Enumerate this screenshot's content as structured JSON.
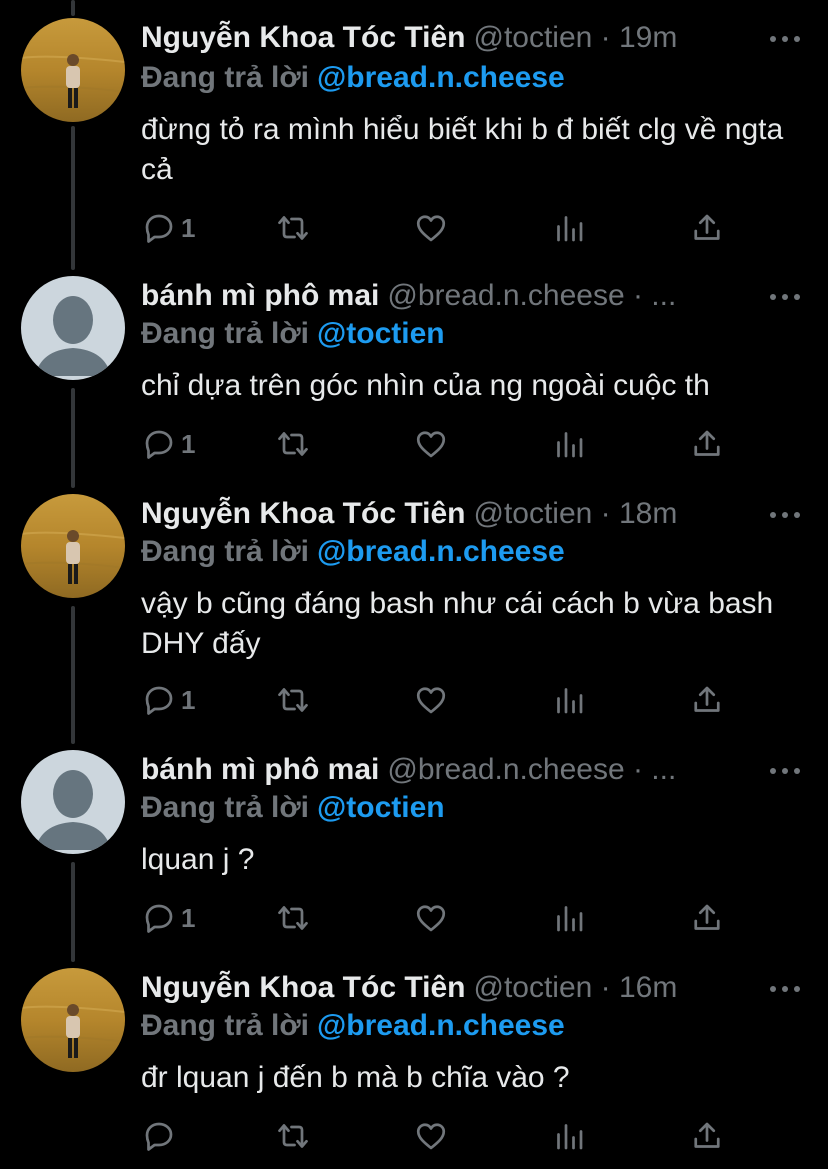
{
  "colors": {
    "background": "#000000",
    "text": "#e7e9ea",
    "secondary": "#71767b",
    "accent": "#1d9bf0",
    "thread_line": "#333639"
  },
  "tweets": [
    {
      "author": "Nguyễn Khoa Tóc Tiên",
      "handle_time": "@toctien · 19m",
      "avatar": "photo-avatar",
      "reply_prefix": "Đang trả lời",
      "reply_handle": "@bread.n.cheese",
      "text": "đừng tỏ ra mình hiểu biết khi b đ biết clg về ngta cả",
      "reply_count": "1"
    },
    {
      "author": "bánh mì phô mai",
      "handle_time": "@bread.n.cheese · ...",
      "avatar": "default-avatar",
      "reply_prefix": "Đang trả lời",
      "reply_handle": "@toctien",
      "text": "chỉ dựa trên góc nhìn của ng ngoài cuộc th",
      "reply_count": "1"
    },
    {
      "author": "Nguyễn Khoa Tóc Tiên",
      "handle_time": "@toctien · 18m",
      "avatar": "photo-avatar",
      "reply_prefix": "Đang trả lời",
      "reply_handle": "@bread.n.cheese",
      "text": "vậy b cũng đáng bash như cái cách b vừa bash DHY đấy",
      "reply_count": "1"
    },
    {
      "author": "bánh mì phô mai",
      "handle_time": "@bread.n.cheese · ...",
      "avatar": "default-avatar",
      "reply_prefix": "Đang trả lời",
      "reply_handle": "@toctien",
      "text": "lquan j ?",
      "reply_count": "1"
    },
    {
      "author": "Nguyễn Khoa Tóc Tiên",
      "handle_time": "@toctien · 16m",
      "avatar": "photo-avatar",
      "reply_prefix": "Đang trả lời",
      "reply_handle": "@bread.n.cheese",
      "text": "đr lquan j đến b mà b chĩa vào ?",
      "reply_count": ""
    }
  ],
  "action_icons": [
    "reply-icon",
    "retweet-icon",
    "like-icon",
    "analytics-icon",
    "share-icon"
  ]
}
